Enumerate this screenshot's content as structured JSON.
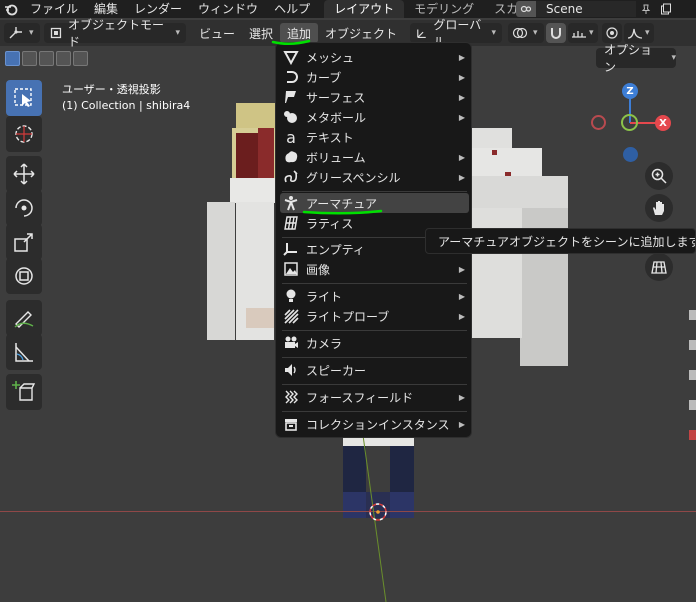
{
  "topbar": {
    "menus": [
      "ファイル",
      "編集",
      "レンダー",
      "ウィンドウ",
      "ヘルプ"
    ],
    "workspaces": [
      {
        "label": "レイアウト",
        "active": true
      },
      {
        "label": "モデリング",
        "active": false
      },
      {
        "label": "スカル",
        "active": false
      }
    ],
    "scene_name": "Scene"
  },
  "header": {
    "mode_label": "オブジェクトモード",
    "menus": [
      {
        "label": "ビュー",
        "active": false
      },
      {
        "label": "選択",
        "active": false
      },
      {
        "label": "追加",
        "active": true
      },
      {
        "label": "オブジェクト",
        "active": false
      }
    ],
    "transform_orientation": "グローバル",
    "options_label": "オプション"
  },
  "viewport": {
    "view_name": "ユーザー・透視投影",
    "collection_info": "(1) Collection | shibira4"
  },
  "gizmo": {
    "z": "Z",
    "x": "X"
  },
  "add_menu": {
    "items": [
      {
        "label": "メッシュ",
        "icon": "mesh-icon",
        "submenu": true
      },
      {
        "label": "カーブ",
        "icon": "curve-icon",
        "submenu": true
      },
      {
        "label": "サーフェス",
        "icon": "surface-icon",
        "submenu": true
      },
      {
        "label": "メタボール",
        "icon": "metaball-icon",
        "submenu": true
      },
      {
        "label": "テキスト",
        "icon": "text-icon",
        "submenu": false
      },
      {
        "label": "ボリューム",
        "icon": "volume-icon",
        "submenu": true
      },
      {
        "label": "グリースペンシル",
        "icon": "grease-pencil-icon",
        "submenu": true
      },
      {
        "label": "アーマチュア",
        "icon": "armature-icon",
        "submenu": false,
        "highlighted": true
      },
      {
        "label": "ラティス",
        "icon": "lattice-icon",
        "submenu": false
      },
      {
        "label": "エンプティ",
        "icon": "empty-icon",
        "submenu": true
      },
      {
        "label": "画像",
        "icon": "image-icon",
        "submenu": true
      },
      {
        "label": "ライト",
        "icon": "light-icon",
        "submenu": true
      },
      {
        "label": "ライトプローブ",
        "icon": "light-probe-icon",
        "submenu": true
      },
      {
        "label": "カメラ",
        "icon": "camera-icon",
        "submenu": false
      },
      {
        "label": "スピーカー",
        "icon": "speaker-icon",
        "submenu": false
      },
      {
        "label": "フォースフィールド",
        "icon": "force-field-icon",
        "submenu": true
      },
      {
        "label": "コレクションインスタンス",
        "icon": "collection-instance-icon",
        "submenu": true
      }
    ]
  },
  "tooltip": {
    "text": "アーマチュアオブジェクトをシーンに追加します."
  },
  "colors": {
    "accent": "#4772b3",
    "annotation": "#00e000",
    "axis_x": "#e5484d",
    "axis_y": "#8bc34a",
    "axis_z": "#3d7ed6"
  }
}
